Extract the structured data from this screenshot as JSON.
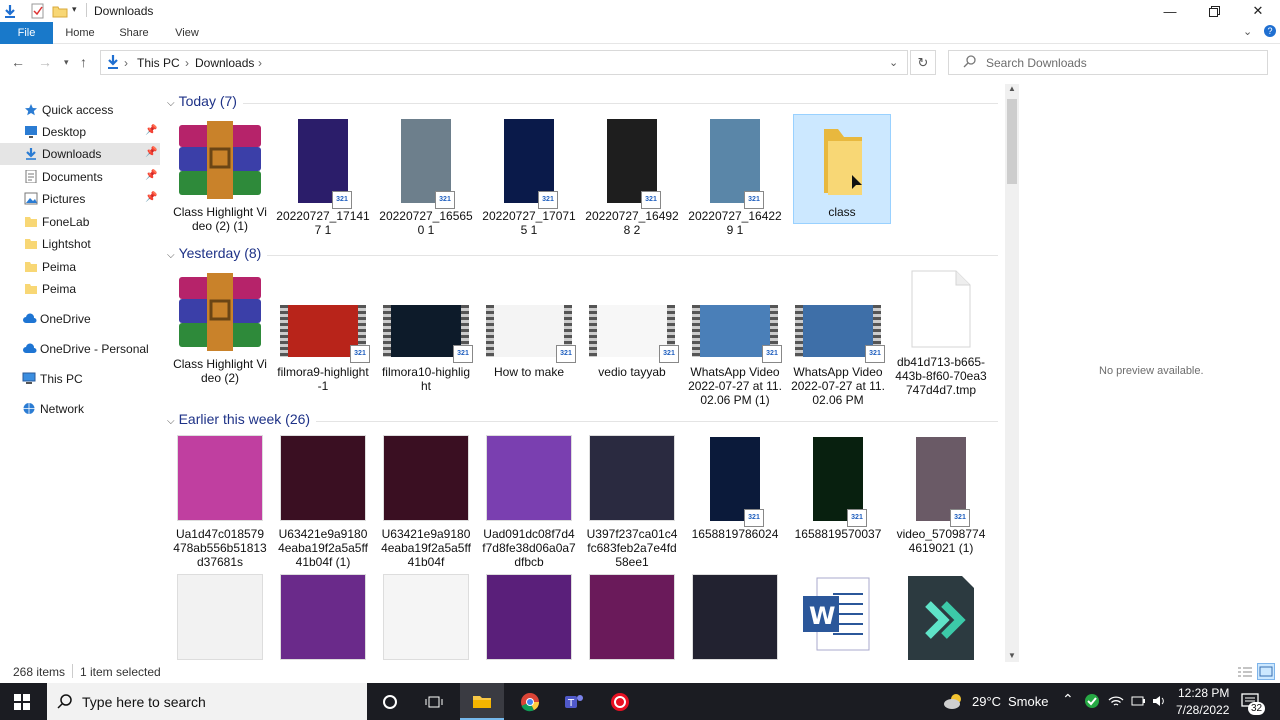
{
  "window": {
    "title": "Downloads"
  },
  "ribbon": {
    "tabs": [
      "File",
      "Home",
      "Share",
      "View"
    ]
  },
  "address": {
    "parts": [
      "This PC",
      "Downloads"
    ],
    "search_placeholder": "Search Downloads"
  },
  "nav": [
    {
      "label": "Quick access",
      "pinned": false,
      "icon": "star-icon"
    },
    {
      "label": "Desktop",
      "pinned": true,
      "icon": "desktop-icon"
    },
    {
      "label": "Downloads",
      "pinned": true,
      "icon": "download-arrow-icon",
      "selected": true
    },
    {
      "label": "Documents",
      "pinned": true,
      "icon": "documents-icon"
    },
    {
      "label": "Pictures",
      "pinned": true,
      "icon": "pictures-icon"
    },
    {
      "label": "FoneLab",
      "pinned": false,
      "icon": "folder-icon"
    },
    {
      "label": "Lightshot",
      "pinned": false,
      "icon": "folder-icon"
    },
    {
      "label": "Peima",
      "pinned": false,
      "icon": "folder-icon"
    },
    {
      "label": "Peima",
      "pinned": false,
      "icon": "folder-icon"
    },
    {
      "label": "OneDrive",
      "pinned": false,
      "icon": "cloud-icon"
    },
    {
      "label": "OneDrive - Personal",
      "pinned": false,
      "icon": "cloud-icon"
    },
    {
      "label": "This PC",
      "pinned": false,
      "icon": "computer-icon"
    },
    {
      "label": "Network",
      "pinned": false,
      "icon": "network-icon"
    }
  ],
  "groups": [
    {
      "header": "Today (7)",
      "items": [
        {
          "name": "Class Highlight Video (2) (1)",
          "kind": "archive"
        },
        {
          "name": "20220727_171417 1",
          "kind": "video-portrait",
          "color": "#2b1d6a"
        },
        {
          "name": "20220727_165650 1",
          "kind": "video-portrait",
          "color": "#6d7f8c"
        },
        {
          "name": "20220727_170715 1",
          "kind": "video-portrait",
          "color": "#0a1a4a"
        },
        {
          "name": "20220727_164928 2",
          "kind": "video-portrait",
          "color": "#1e1e1e"
        },
        {
          "name": "20220727_164229 1",
          "kind": "video-portrait",
          "color": "#5a86a8"
        },
        {
          "name": "class",
          "kind": "folder",
          "selected": true
        }
      ]
    },
    {
      "header": "Yesterday (8)",
      "items": [
        {
          "name": "Class Highlight Video (2)",
          "kind": "archive"
        },
        {
          "name": "filmora9-highlight-1",
          "kind": "video-film",
          "color": "#b8241a"
        },
        {
          "name": "filmora10-highlight",
          "kind": "video-film",
          "color": "#0d1b2a"
        },
        {
          "name": "How to make",
          "kind": "video-film",
          "color": "#f4f4f4"
        },
        {
          "name": "vedio tayyab",
          "kind": "video-film",
          "color": "#f7f7f7"
        },
        {
          "name": "WhatsApp Video 2022-07-27 at 11.02.06 PM (1)",
          "kind": "video-film",
          "color": "#4a7fb8"
        },
        {
          "name": "WhatsApp Video 2022-07-27 at 11.02.06 PM",
          "kind": "video-film",
          "color": "#3e6fa8"
        },
        {
          "name": "db41d713-b665-443b-8f60-70ea3747d4d7.tmp",
          "kind": "file"
        }
      ]
    },
    {
      "header": "Earlier this week (26)",
      "items": [
        {
          "name": "Ua1d47c018579478ab556b51813d37681s",
          "kind": "image",
          "color": "#c03fa0"
        },
        {
          "name": "U63421e9a91804eaba19f2a5a5ff41b04f (1)",
          "kind": "image",
          "color": "#3a0f22"
        },
        {
          "name": "U63421e9a91804eaba19f2a5a5ff41b04f",
          "kind": "image",
          "color": "#3a0f22"
        },
        {
          "name": "Uad091dc08f7d4f7d8fe38d06a0a7dfbcb",
          "kind": "image",
          "color": "#7a3fb0"
        },
        {
          "name": "U397f237ca01c4fc683feb2a7e4fd58ee1",
          "kind": "image",
          "color": "#2a2a40"
        },
        {
          "name": "1658819786024",
          "kind": "video-portrait",
          "color": "#0b1a3a"
        },
        {
          "name": "1658819570037",
          "kind": "video-portrait",
          "color": "#08200f"
        },
        {
          "name": "video_570987744619021 (1)",
          "kind": "video-portrait",
          "color": "#6a5a66"
        }
      ]
    },
    {
      "header": "",
      "items": [
        {
          "name": "",
          "kind": "image",
          "color": "#f2f2f2"
        },
        {
          "name": "",
          "kind": "image",
          "color": "#6a2a8a"
        },
        {
          "name": "",
          "kind": "image",
          "color": "#f5f5f5"
        },
        {
          "name": "",
          "kind": "image",
          "color": "#5a1f7a"
        },
        {
          "name": "",
          "kind": "image",
          "color": "#6a1a5a"
        },
        {
          "name": "",
          "kind": "image",
          "color": "#222230"
        },
        {
          "name": "",
          "kind": "word-doc"
        },
        {
          "name": "",
          "kind": "filmora-app"
        }
      ]
    }
  ],
  "preview": {
    "text": "No preview available."
  },
  "status": {
    "count": "268 items",
    "selected": "1 item selected"
  },
  "taskbar": {
    "search_placeholder": "Type here to search",
    "weather_temp": "29°C",
    "weather_text": "Smoke",
    "time": "12:28 PM",
    "date": "7/28/2022",
    "notifications": "32"
  }
}
